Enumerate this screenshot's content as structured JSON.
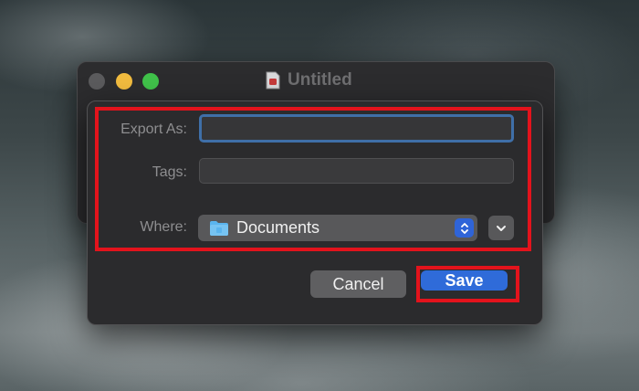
{
  "window": {
    "title": "Untitled"
  },
  "sheet": {
    "export_as": {
      "label": "Export As:",
      "value": "",
      "placeholder": ""
    },
    "tags": {
      "label": "Tags:",
      "value": "",
      "placeholder": ""
    },
    "where": {
      "label": "Where:",
      "selected": "Documents",
      "icon": "folder-icon"
    },
    "buttons": {
      "cancel_label": "Cancel",
      "save_label": "Save"
    }
  },
  "colors": {
    "accent": "#2f6bd9",
    "highlight": "#e3131c",
    "focus_ring": "#3f6fa8"
  }
}
